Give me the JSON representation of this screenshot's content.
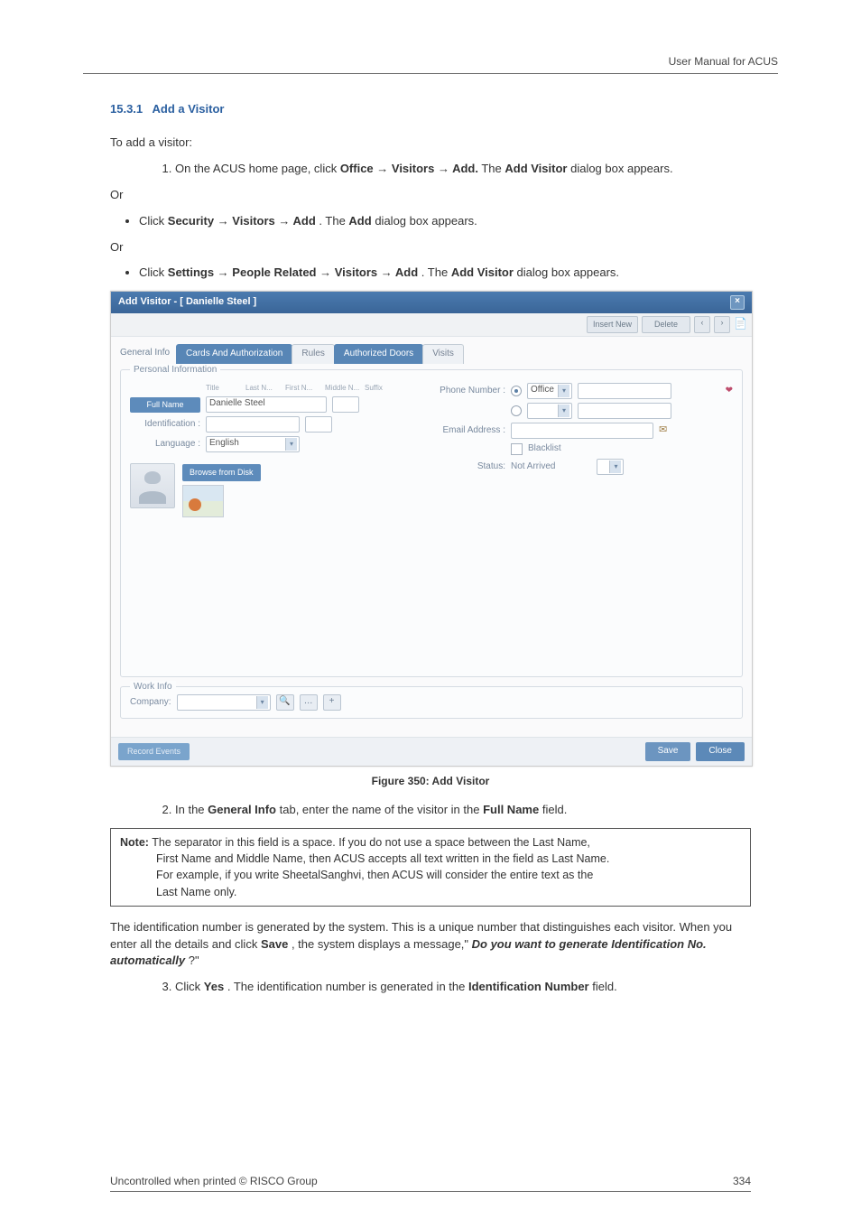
{
  "header": {
    "right": "User Manual for ACUS"
  },
  "section": {
    "heading_number": "15.3.1",
    "heading_title": "Add a Visitor",
    "intro": "To add a visitor:",
    "step1_prefix": "On the ACUS home page, click ",
    "step1_path": "Office → Visitors → Add.",
    "step1_middle": " The ",
    "step1_bold2": "Add Visitor",
    "step1_suffix": " dialog box appears.",
    "or": "Or",
    "bullet1_prefix": "Click ",
    "bullet1_path": "Security → Visitors → Add",
    "bullet1_middle": ". The ",
    "bullet1_bold2": "Add",
    "bullet1_suffix": " dialog box appears.",
    "bullet2_prefix": "Click ",
    "bullet2_path": "Settings → People Related → Visitors → Add",
    "bullet2_middle": ". The ",
    "bullet2_bold2": "Add Visitor",
    "bullet2_suffix": " dialog box appears."
  },
  "dialog": {
    "title": "Add Visitor - [ Danielle Steel ]",
    "toolbar": {
      "btn1": "Insert New",
      "btn2": "Delete"
    },
    "tabs": {
      "general": "General Info",
      "cards": "Cards And Authorization",
      "rules": "Rules",
      "doors": "Authorized Doors",
      "visits": "Visits"
    },
    "personal": {
      "legend": "Personal Information",
      "tiny": {
        "title": "Title",
        "last": "Last N...",
        "first": "First N...",
        "middle": "Middle N...",
        "suffix": "Suffix"
      },
      "full_name_btn": "Full Name",
      "full_name_value": "Danielle Steel",
      "identification_label": "Identification :",
      "language_label": "Language :",
      "language_value": "English",
      "browse_btn": "Browse from Disk",
      "phone_label": "Phone Number :",
      "phone_type": "Office",
      "email_label": "Email Address :",
      "blacklist": "Blacklist",
      "status_label": "Status:",
      "status_value": "Not Arrived"
    },
    "work": {
      "legend": "Work Info",
      "company_label": "Company:"
    },
    "footer": {
      "left": "Record Events",
      "save": "Save",
      "close": "Close"
    }
  },
  "figure_caption": "Figure 350: Add Visitor",
  "step2": {
    "prefix": "In the ",
    "bold1": "General Info",
    "mid": " tab, enter the name of the visitor in the ",
    "bold2": "Full Name",
    "suffix": " field."
  },
  "note": {
    "label": "Note:",
    "line1": " The separator in this field is a space. If you do not use a space between the Last Name,",
    "line2": "First Name and Middle Name, then ACUS accepts all text written in the field as Last Name.",
    "line3": "For example, if you write SheetalSanghvi, then ACUS will consider the entire text as the",
    "line4": "Last Name only."
  },
  "after_note": {
    "para1_a": "The identification number is generated by the system. This is a unique number that distinguishes each visitor. When you enter all the details and click ",
    "bold_save": "Save",
    "para1_b": ", the system displays a message,\" ",
    "italic_q": "Do you want to generate Identification No. automatically",
    "para1_c": "?\""
  },
  "step3": {
    "prefix": "Click ",
    "bold1": "Yes",
    "mid": ". The identification number is generated in the ",
    "bold2": "Identification Number",
    "suffix": " field."
  },
  "footer": {
    "left": "Uncontrolled when printed © RISCO Group",
    "right": "334"
  }
}
